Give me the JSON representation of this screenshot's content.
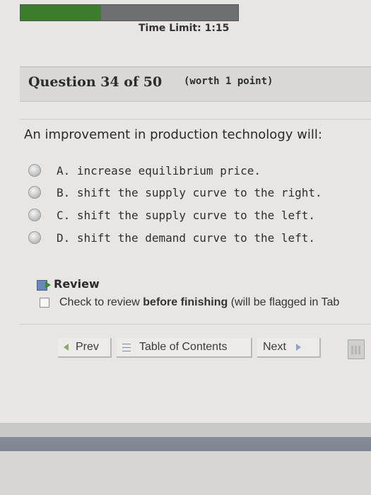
{
  "progress": {
    "fraction": 0.37,
    "fill_color": "#3b7d2c"
  },
  "timer": {
    "text": "Time Limit: 1:15"
  },
  "question": {
    "title": "Question 34 of 50",
    "worth": "(worth 1 point)",
    "prompt": "An improvement in production technology will:",
    "choices": [
      {
        "label": "A. increase equilibrium price."
      },
      {
        "label": "B. shift the supply curve to the right."
      },
      {
        "label": "C. shift the supply curve to the left."
      },
      {
        "label": "D. shift the demand curve to the left."
      }
    ]
  },
  "review": {
    "title": "Review",
    "check_prefix": "Check to review ",
    "check_bold": "before finishing",
    "check_suffix": " (will be flagged in Tab"
  },
  "nav": {
    "prev": "Prev",
    "toc": "Table of Contents",
    "next": "Next"
  }
}
